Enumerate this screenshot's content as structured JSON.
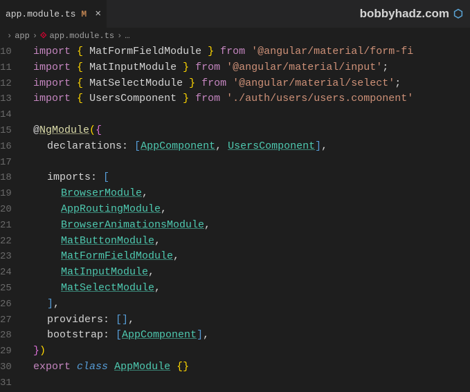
{
  "watermark": {
    "text": "bobbyhadz.com",
    "icon": "cube"
  },
  "tab": {
    "filename": "app.module.ts",
    "modified_indicator": "M"
  },
  "breadcrumb": {
    "items": [
      {
        "label": "app",
        "icon": "folder"
      },
      {
        "label": "app.module.ts",
        "icon": "angular"
      },
      {
        "label": "…"
      }
    ]
  },
  "gutter": {
    "start": 10,
    "end": 31
  },
  "code": {
    "lines": [
      {
        "t": [
          [
            "kw-import",
            "import"
          ],
          [
            "punct",
            " "
          ],
          [
            "brace-yellow2",
            "{"
          ],
          [
            "punct",
            " "
          ],
          [
            "class-name-plain",
            "MatFormFieldModule"
          ],
          [
            "punct",
            " "
          ],
          [
            "brace-yellow2",
            "}"
          ],
          [
            "punct",
            " "
          ],
          [
            "kw-from",
            "from"
          ],
          [
            "punct",
            " "
          ],
          [
            "string",
            "'@angular/material/form-fi"
          ]
        ],
        "indent": 1
      },
      {
        "t": [
          [
            "kw-import",
            "import"
          ],
          [
            "punct",
            " "
          ],
          [
            "brace-yellow2",
            "{"
          ],
          [
            "punct",
            " "
          ],
          [
            "class-name-plain",
            "MatInputModule"
          ],
          [
            "punct",
            " "
          ],
          [
            "brace-yellow2",
            "}"
          ],
          [
            "punct",
            " "
          ],
          [
            "kw-from",
            "from"
          ],
          [
            "punct",
            " "
          ],
          [
            "string",
            "'@angular/material/input'"
          ],
          [
            "punct",
            ";"
          ]
        ],
        "indent": 1
      },
      {
        "t": [
          [
            "kw-import",
            "import"
          ],
          [
            "punct",
            " "
          ],
          [
            "brace-yellow2",
            "{"
          ],
          [
            "punct",
            " "
          ],
          [
            "class-name-plain",
            "MatSelectModule"
          ],
          [
            "punct",
            " "
          ],
          [
            "brace-yellow2",
            "}"
          ],
          [
            "punct",
            " "
          ],
          [
            "kw-from",
            "from"
          ],
          [
            "punct",
            " "
          ],
          [
            "string",
            "'@angular/material/select'"
          ],
          [
            "punct",
            ";"
          ]
        ],
        "indent": 1
      },
      {
        "t": [
          [
            "kw-import",
            "import"
          ],
          [
            "punct",
            " "
          ],
          [
            "brace-yellow2",
            "{"
          ],
          [
            "punct",
            " "
          ],
          [
            "class-name-plain",
            "UsersComponent"
          ],
          [
            "punct",
            " "
          ],
          [
            "brace-yellow2",
            "}"
          ],
          [
            "punct",
            " "
          ],
          [
            "kw-from",
            "from"
          ],
          [
            "punct",
            " "
          ],
          [
            "string",
            "'./auth/users/users.component'"
          ]
        ],
        "indent": 1
      },
      {
        "t": [],
        "indent": 0
      },
      {
        "t": [
          [
            "at-sign",
            "@"
          ],
          [
            "decorator",
            "NgModule"
          ],
          [
            "brace-yellow2",
            "("
          ],
          [
            "brace-pink",
            "{"
          ]
        ],
        "indent": 1
      },
      {
        "t": [
          [
            "prop-key",
            "declarations"
          ],
          [
            "punct",
            ": "
          ],
          [
            "brace-blue",
            "["
          ],
          [
            "class-name",
            "AppComponent"
          ],
          [
            "punct",
            ", "
          ],
          [
            "class-name",
            "UsersComponent"
          ],
          [
            "brace-blue",
            "]"
          ],
          [
            "punct",
            ","
          ]
        ],
        "indent": 2
      },
      {
        "t": [],
        "indent": 0
      },
      {
        "t": [
          [
            "prop-key",
            "imports"
          ],
          [
            "punct",
            ": "
          ],
          [
            "brace-blue",
            "["
          ]
        ],
        "indent": 2
      },
      {
        "t": [
          [
            "class-name",
            "BrowserModule"
          ],
          [
            "punct",
            ","
          ]
        ],
        "indent": 3
      },
      {
        "t": [
          [
            "class-name",
            "AppRoutingModule"
          ],
          [
            "punct",
            ","
          ]
        ],
        "indent": 3
      },
      {
        "t": [
          [
            "class-name",
            "BrowserAnimationsModule"
          ],
          [
            "punct",
            ","
          ]
        ],
        "indent": 3
      },
      {
        "t": [
          [
            "class-name",
            "MatButtonModule"
          ],
          [
            "punct",
            ","
          ]
        ],
        "indent": 3
      },
      {
        "t": [
          [
            "class-name",
            "MatFormFieldModule"
          ],
          [
            "punct",
            ","
          ]
        ],
        "indent": 3
      },
      {
        "t": [
          [
            "class-name",
            "MatInputModule"
          ],
          [
            "punct",
            ","
          ]
        ],
        "indent": 3
      },
      {
        "t": [
          [
            "class-name",
            "MatSelectModule"
          ],
          [
            "punct",
            ","
          ]
        ],
        "indent": 3
      },
      {
        "t": [
          [
            "brace-blue",
            "]"
          ],
          [
            "punct",
            ","
          ]
        ],
        "indent": 2
      },
      {
        "t": [
          [
            "prop-key",
            "providers"
          ],
          [
            "punct",
            ": "
          ],
          [
            "brace-blue",
            "["
          ],
          [
            "brace-blue",
            "]"
          ],
          [
            "punct",
            ","
          ]
        ],
        "indent": 2
      },
      {
        "t": [
          [
            "prop-key",
            "bootstrap"
          ],
          [
            "punct",
            ": "
          ],
          [
            "brace-blue",
            "["
          ],
          [
            "class-name",
            "AppComponent"
          ],
          [
            "brace-blue",
            "]"
          ],
          [
            "punct",
            ","
          ]
        ],
        "indent": 2
      },
      {
        "t": [
          [
            "brace-pink",
            "}"
          ],
          [
            "brace-yellow2",
            ")"
          ]
        ],
        "indent": 1
      },
      {
        "t": [
          [
            "kw-export",
            "export"
          ],
          [
            "punct",
            " "
          ],
          [
            "kw-class",
            "class"
          ],
          [
            "punct",
            " "
          ],
          [
            "class-name",
            "AppModule"
          ],
          [
            "punct",
            " "
          ],
          [
            "brace-yellow2",
            "{"
          ],
          [
            "brace-yellow2",
            "}"
          ]
        ],
        "indent": 1
      },
      {
        "t": [],
        "indent": 0
      }
    ]
  }
}
